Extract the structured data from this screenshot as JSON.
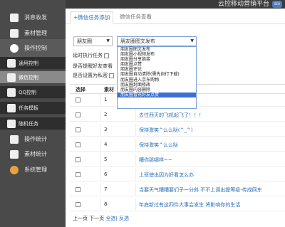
{
  "header": {
    "brand": "云控移动营销平台",
    "badge": "SEO"
  },
  "sidebar": {
    "items": [
      {
        "label": "消息收发"
      },
      {
        "label": "素材管理"
      },
      {
        "label": "操作控制"
      },
      {
        "label": "通用控制"
      },
      {
        "label": "微信控制"
      },
      {
        "label": "QQ控制"
      },
      {
        "label": "任务模板"
      },
      {
        "label": "随机任务"
      },
      {
        "label": "操作统计"
      },
      {
        "label": "素材统计"
      },
      {
        "label": "系统管理"
      }
    ]
  },
  "tabs": [
    {
      "label": "+微信任务添加"
    },
    {
      "label": "微信任务查看"
    }
  ],
  "filters": {
    "category": "朋友圈",
    "type": "朋友圈图文发布",
    "options": [
      "朋友圈图文发布",
      "朋友圈小视频发布",
      "朋友圈分享链接",
      "朋友圈点赞",
      "朋友圈评论",
      "朋友圈自动清除(需先自行下载)",
      "朋友圈进入京东购物",
      "朋友圈封面修改",
      "朋友圈内容删除",
      "朋友圈冒充好友点赞"
    ],
    "selected_index": 9
  },
  "form": {
    "run_label": "延时执行任务",
    "remind_label": "是否提醒好友查看",
    "private_label": "是否设置为私密"
  },
  "table": {
    "headers": [
      "选择",
      "素材"
    ],
    "rows": [
      {
        "num": "1",
        "content": "...了"
      },
      {
        "num": "2",
        "content": "去往西天的飞机起飞了！！！"
      },
      {
        "num": "3",
        "content": "保持激笑^么么哒(^_^)"
      },
      {
        "num": "4",
        "content": "保持激笑^么么哒"
      },
      {
        "num": "5",
        "content": "糟你那哪样~~"
      },
      {
        "num": "6",
        "content": "上班使出因为好看怎么办"
      },
      {
        "num": "7",
        "content": "当要天气糟糟要们子一分斜 不不上调出提等级-传成网东"
      },
      {
        "num": "8",
        "content": "年底新过有这四件大事会发生 将影响你的生活"
      }
    ]
  },
  "pager": {
    "prev_next": "上一页 下一页",
    "links": "全选| 反选"
  }
}
